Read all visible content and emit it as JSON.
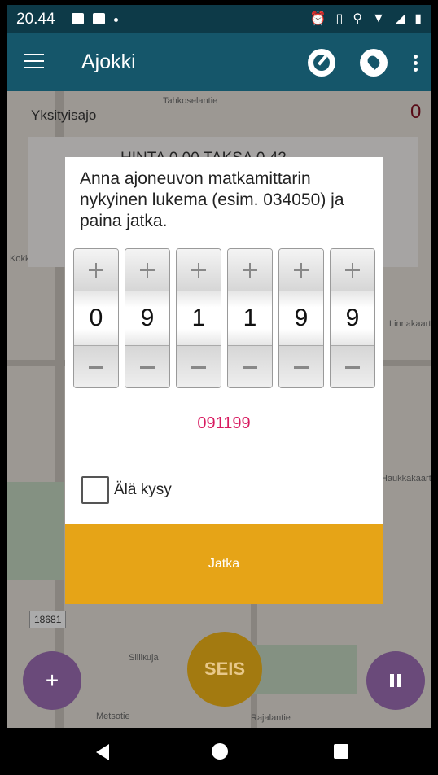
{
  "status_bar": {
    "time": "20.44",
    "icons": [
      "image-icon",
      "gmail-icon",
      "notification-dot",
      "alarm-icon",
      "vibrate-icon",
      "location-icon",
      "wifi-icon",
      "signal-icon",
      "battery-icon"
    ]
  },
  "app_bar": {
    "title": "Ajokki",
    "icons": [
      "menu-icon",
      "speedometer-icon",
      "location-off-icon",
      "more-vert-icon"
    ]
  },
  "background": {
    "trip_type": "Yksityisajo",
    "counter": "0",
    "fare_partial": "HINTA 0,00  TAKSA  0,42",
    "map_labels": [
      "Tahkoselantie",
      "Kokkokankaantie",
      "Linnakaarto",
      "Haukkakaarto",
      "Siiliкuja",
      "Metsotie",
      "Rajalantie"
    ],
    "road_badge": "18681"
  },
  "dialog": {
    "prompt": "Anna ajoneuvon matkamittarin nykyinen lukema (esim. 034050) ja paina jatka.",
    "digits": [
      "0",
      "9",
      "1",
      "1",
      "9",
      "9"
    ],
    "reading": "091199",
    "checkbox_label": "Älä kysy",
    "checkbox_checked": false,
    "continue_label": "Jatka"
  },
  "fabs": {
    "add_label": "+",
    "stop_label": "SEIS"
  },
  "colors": {
    "appbar": "#15566a",
    "statusbar": "#0d3a48",
    "accent_pink": "#d81b60",
    "continue_button": "#e6a417",
    "fab_purple": "#6a4a7a",
    "fab_stop": "#a37a10"
  }
}
